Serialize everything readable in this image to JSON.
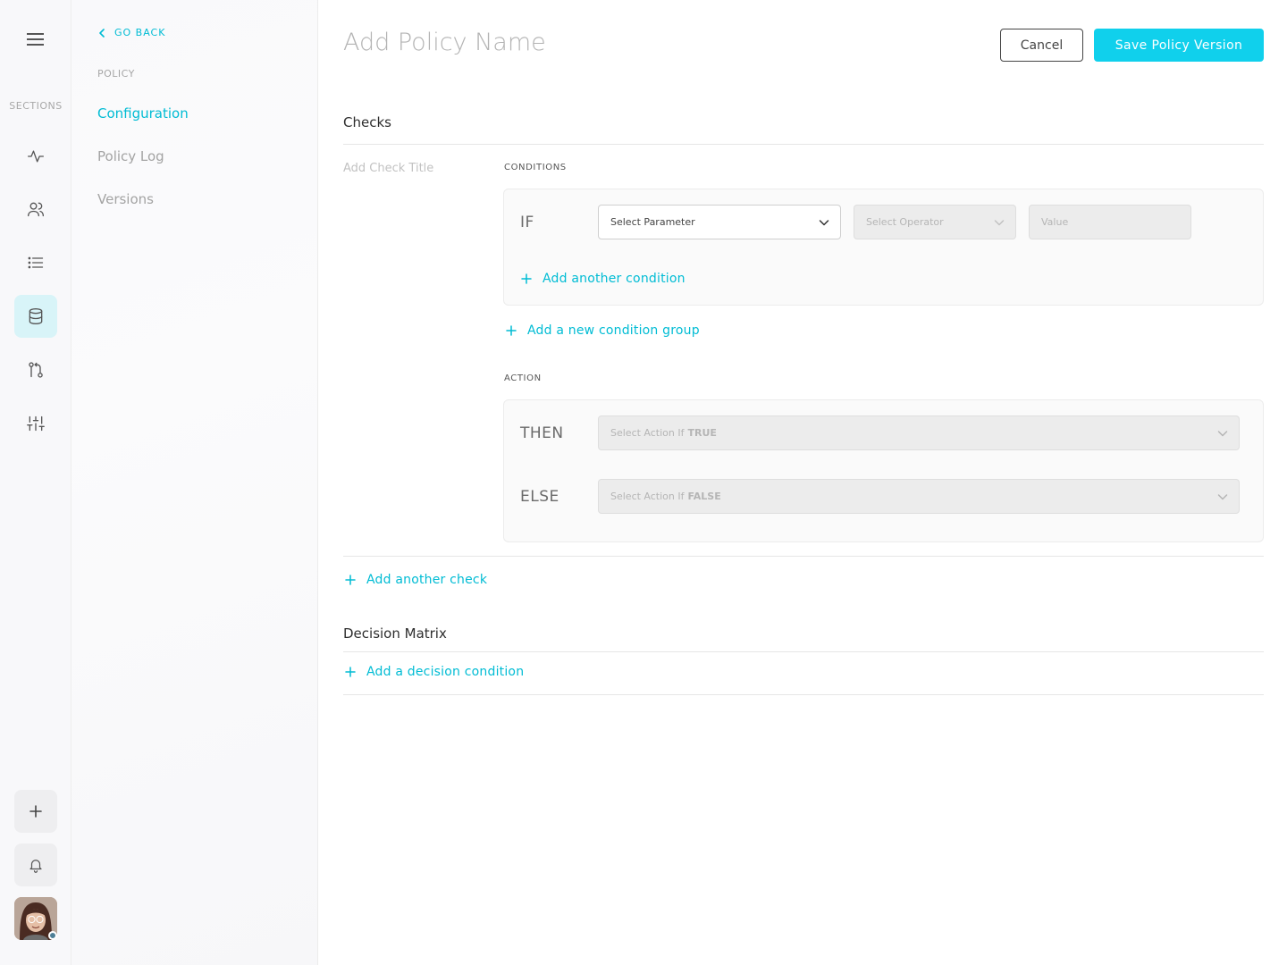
{
  "rail": {
    "sections_label": "SECTIONS",
    "items": [
      {
        "name": "activity-icon"
      },
      {
        "name": "users-icon"
      },
      {
        "name": "list-icon"
      },
      {
        "name": "database-icon",
        "active": true
      },
      {
        "name": "git-branch-icon"
      },
      {
        "name": "sliders-icon"
      }
    ],
    "bottom": [
      {
        "name": "plus-icon"
      },
      {
        "name": "bell-icon"
      }
    ],
    "accent_color": "#00bcd4",
    "active_bg": "#d8f4f8"
  },
  "subnav": {
    "go_back": "GO BACK",
    "section_title": "POLICY",
    "items": [
      {
        "label": "Configuration",
        "active": true
      },
      {
        "label": "Policy Log",
        "active": false
      },
      {
        "label": "Versions",
        "active": false
      }
    ]
  },
  "header": {
    "title_placeholder": "Add Policy Name",
    "cancel_label": "Cancel",
    "save_label": "Save Policy Version",
    "save_color": "#10d0ec"
  },
  "checks": {
    "heading": "Checks",
    "check_title_placeholder": "Add Check Title",
    "conditions_label": "CONDITIONS",
    "if_keyword": "IF",
    "parameter_select": "Select Parameter",
    "operator_select": "Select Operator",
    "value_placeholder": "Value",
    "add_condition": "Add another condition",
    "add_condition_group": "Add a new condition group",
    "action_label": "ACTION",
    "then_keyword": "THEN",
    "else_keyword": "ELSE",
    "then_select_prefix": "Select Action If",
    "then_select_bold": "TRUE",
    "else_select_prefix": "Select Action If",
    "else_select_bold": "FALSE",
    "add_check": "Add another check"
  },
  "decision": {
    "heading": "Decision Matrix",
    "add_condition": "Add a decision condition"
  }
}
